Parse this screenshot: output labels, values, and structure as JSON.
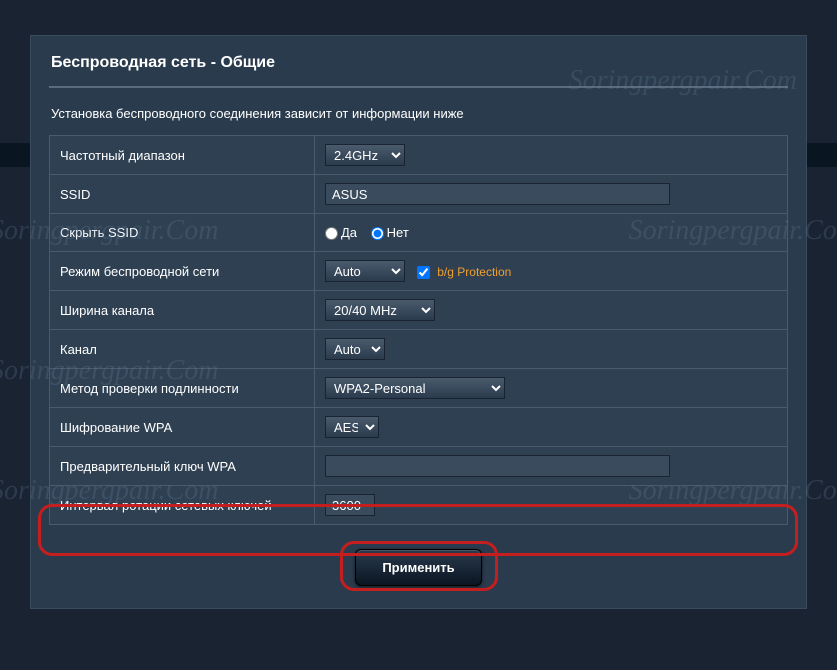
{
  "watermark": "Soringpergpair.Com",
  "header": {
    "title": "Беспроводная сеть - Общие"
  },
  "description": "Установка беспроводного соединения зависит от информации ниже",
  "rows": {
    "freq": {
      "label": "Частотный диапазон",
      "value": "2.4GHz"
    },
    "ssid": {
      "label": "SSID",
      "value": "ASUS"
    },
    "hide": {
      "label": "Скрыть SSID",
      "yes": "Да",
      "no": "Нет"
    },
    "mode": {
      "label": "Режим беспроводной сети",
      "value": "Auto",
      "bg": "b/g Protection"
    },
    "width": {
      "label": "Ширина канала",
      "value": "20/40 MHz"
    },
    "channel": {
      "label": "Канал",
      "value": "Auto"
    },
    "auth": {
      "label": "Метод проверки подлинности",
      "value": "WPA2-Personal"
    },
    "encrypt": {
      "label": "Шифрование WPA",
      "value": "AES"
    },
    "key": {
      "label": "Предварительный ключ WPA",
      "value": ""
    },
    "interval": {
      "label": "Интервал ротации сетевых ключей",
      "value": "3600"
    }
  },
  "apply": "Применить"
}
